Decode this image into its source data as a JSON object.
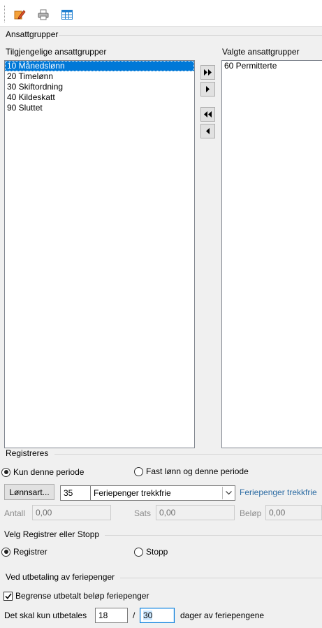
{
  "toolbar": {
    "icons": [
      "edit-icon",
      "print-icon",
      "calendar-grid-icon"
    ]
  },
  "ansattgrupper": {
    "title": "Ansattgrupper",
    "available_label": "Tilgjengelige ansattgrupper",
    "selected_label": "Valgte ansattgrupper",
    "available_items": [
      "10 Månedslønn",
      "20 Timelønn",
      "30 Skiftordning",
      "40 Kildeskatt",
      "90 Sluttet"
    ],
    "selected_available_index": 0,
    "selected_items": [
      "60 Permitterte"
    ],
    "buttons": {
      "add_all": "▶▶",
      "add_one": "▶",
      "remove_all": "◀◀",
      "remove_one": "◀"
    }
  },
  "registreres": {
    "title": "Registreres",
    "radio_kun": "Kun denne periode",
    "radio_fast": "Fast lønn og denne periode",
    "selected": "kun",
    "lonnsart_button": "Lønnsart...",
    "lonnsart_code": "35",
    "lonnsart_name": "Feriepenger trekkfrie",
    "lonnsart_desc": "Feriepenger trekkfrie",
    "antall_label": "Antall",
    "antall_value": "0,00",
    "sats_label": "Sats",
    "sats_value": "0,00",
    "belop_label": "Beløp",
    "belop_value": "0,00"
  },
  "velg": {
    "title": "Velg Registrer eller Stopp",
    "radio_registrer": "Registrer",
    "radio_stopp": "Stopp",
    "selected": "registrer"
  },
  "feriepenger": {
    "title": "Ved utbetaling av feriepenger",
    "checkbox_label": "Begrense utbetalt beløp feriepenger",
    "checked": true,
    "prefix": "Det skal kun utbetales",
    "value1": "18",
    "separator": "/",
    "value2": "30",
    "suffix": "dager av feriepengene"
  },
  "colors": {
    "selection": "#0078d7",
    "link_text": "#2e6da4",
    "background": "#f0f0f0",
    "field_highlight": "#cce8ff"
  }
}
